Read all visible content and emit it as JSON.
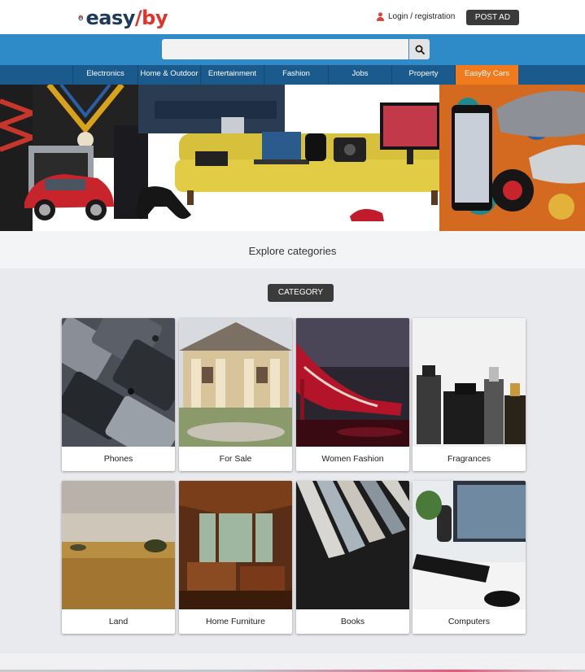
{
  "header": {
    "logo_text_a": "easy",
    "logo_text_b": "/by",
    "login_label": "Login / registration",
    "post_ad_label": "POST AD"
  },
  "search": {
    "placeholder": "",
    "value": ""
  },
  "nav": {
    "items": [
      {
        "label": "Electronics"
      },
      {
        "label": "Home & Outdoor"
      },
      {
        "label": "Entertainment"
      },
      {
        "label": "Fashion"
      },
      {
        "label": "Jobs"
      },
      {
        "label": "Property"
      },
      {
        "label": "EasyBy Cars"
      }
    ]
  },
  "explore": {
    "title": "Explore categories"
  },
  "category_button": "CATEGORY",
  "categories": [
    {
      "label": "Phones",
      "icon": "phones-image"
    },
    {
      "label": "For Sale",
      "icon": "for-sale-image"
    },
    {
      "label": "Women Fashion",
      "icon": "women-fashion-image"
    },
    {
      "label": "Fragrances",
      "icon": "fragrances-image"
    },
    {
      "label": "Land",
      "icon": "land-image"
    },
    {
      "label": "Home Furniture",
      "icon": "home-furniture-image"
    },
    {
      "label": "Books",
      "icon": "books-image"
    },
    {
      "label": "Computers",
      "icon": "computers-image"
    }
  ],
  "colors": {
    "search_band": "#2e8bc7",
    "nav_bar": "#1a5a8c",
    "nav_active": "#f07a1c",
    "dark_button": "#3a3a3a"
  }
}
